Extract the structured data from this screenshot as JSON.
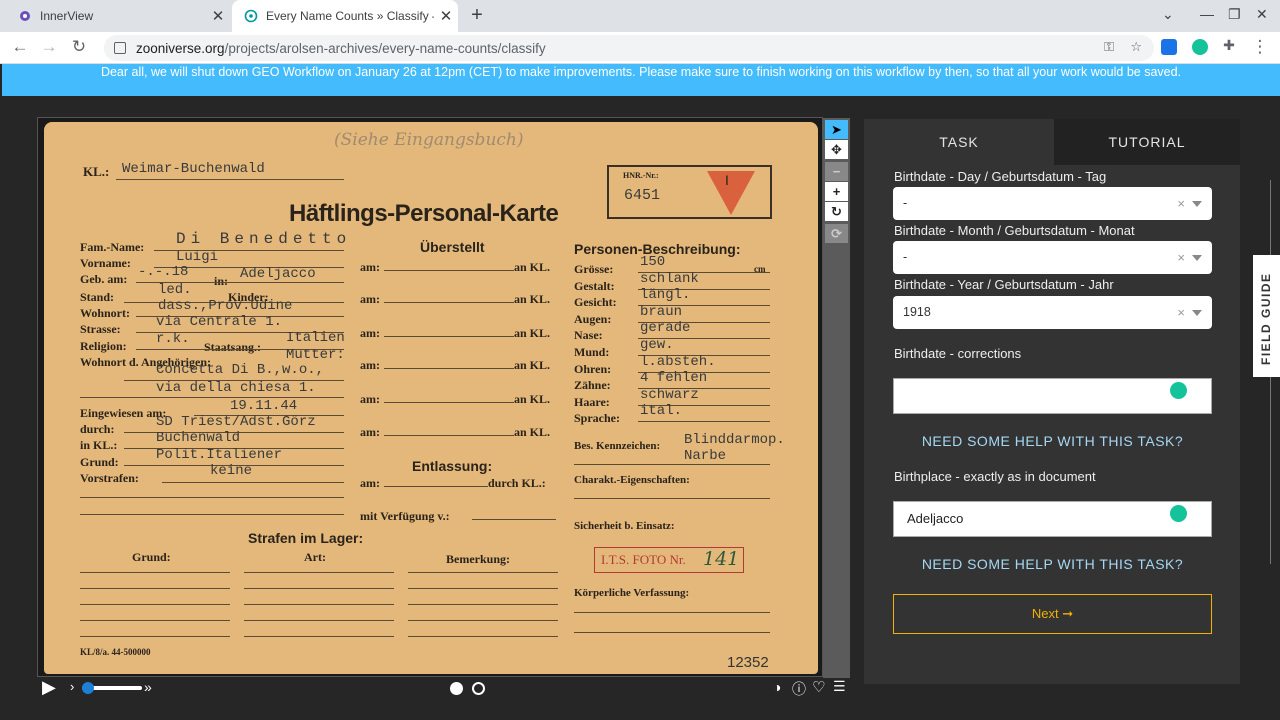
{
  "browser": {
    "tabs": [
      {
        "title": "InnerView"
      },
      {
        "title": "Every Name Counts » Classify –"
      }
    ],
    "url_domain": "zooniverse.org",
    "url_path": "/projects/arolsen-archives/every-name-counts/classify"
  },
  "banner": {
    "text": "Dear all, we will shut down GEO Workflow on January 26 at 12pm (CET) to make improvements. Please make sure to finish working on this workflow by then, so that all your work would be saved."
  },
  "card": {
    "pencil_note": "(Siehe Eingangsbuch)",
    "kl_label": "KL.:",
    "kl_value": "Weimar-Buchenwald",
    "title": "Häftlings-Personal-Karte",
    "hnr_label": "HNR.-Nr.:",
    "prisoner_number": "6451",
    "triangle_letter": "I",
    "ueberstellt": "Überstellt",
    "personen_beschreibung": "Personen-Beschreibung:",
    "left_fields": [
      {
        "label": "Fam.-Name:",
        "value": "Di Benedetto"
      },
      {
        "label": "Vorname:",
        "value": "Luigi"
      },
      {
        "label": "Geb. am:",
        "value": "-.-.18"
      },
      {
        "label": "Stand:",
        "value": "led."
      },
      {
        "label": "Wohnort:",
        "value": "dass.,Prov.Udine"
      },
      {
        "label": "Strasse:",
        "value": "via Centrale 1."
      },
      {
        "label": "Religion:",
        "value": "r.k."
      },
      {
        "label": "Wohnort d. Angehörigen:",
        "value": "Mutter:"
      }
    ],
    "in_label": "in:",
    "birthplace": "Adeljacco",
    "kinder_label": "Kinder:",
    "staatsang_label": "Staatsang.:",
    "staatsang_value": "Italien",
    "angehoerige_line2": "Concetta Di B.,w.o.,",
    "angehoerige_line3": "via della chiesa 1.",
    "eingewiesen_label": "Eingewiesen am:",
    "eingewiesen_value": "19.11.44",
    "durch_label": "durch:",
    "durch_value": "SD Triest/Adst.Görz",
    "in_kl_label": "in KL.:",
    "in_kl_value": "Buchenwald",
    "grund_label": "Grund:",
    "grund_value": "Polit.Italiener",
    "vorstrafen_label": "Vorstrafen:",
    "vorstrafen_value": "keine",
    "am_label": "am:",
    "an_kl_label": "an KL.",
    "entlassung": "Entlassung:",
    "durch_kl_label": "durch KL.:",
    "verfuegung_label": "mit Verfügung v.:",
    "description": [
      {
        "label": "Grösse:",
        "value": "150"
      },
      {
        "label": "Gestalt:",
        "value": "schlank"
      },
      {
        "label": "Gesicht:",
        "value": "längl."
      },
      {
        "label": "Augen:",
        "value": "braun"
      },
      {
        "label": "Nase:",
        "value": "gerade"
      },
      {
        "label": "Mund:",
        "value": "gew."
      },
      {
        "label": "Ohren:",
        "value": "l.absteh."
      },
      {
        "label": "Zähne:",
        "value": "4 fehlen"
      },
      {
        "label": "Haare:",
        "value": "schwarz"
      },
      {
        "label": "Sprache:",
        "value": "ital."
      }
    ],
    "cm_label": "cm",
    "kennzeichen_label": "Bes. Kennzeichen:",
    "kennzeichen_value": "Blinddarmop.",
    "kennzeichen_value2": "Narbe",
    "charakt_label": "Charakt.-Eigenschaften:",
    "sicherheit_label": "Sicherheit b. Einsatz:",
    "stamp_text": "I.T.S. FOTO Nr.",
    "stamp_number": "141",
    "koerper_label": "Körperliche Verfassung:",
    "strafen_title": "Strafen im Lager:",
    "strafen_cols": [
      "Grund:",
      "Art:",
      "Bemerkung:"
    ],
    "form_code": "KL/8/a. 44-500000",
    "doc_number": "12352"
  },
  "panel": {
    "tab_task": "TASK",
    "tab_tutorial": "TUTORIAL",
    "day_label": "Birthdate - Day / Geburtsdatum - Tag",
    "day_value": "-",
    "month_label": "Birthdate - Month / Geburtsdatum - Monat",
    "month_value": "-",
    "year_label": "Birthdate - Year / Geburtsdatum - Jahr",
    "year_value": "1918",
    "corrections_label": "Birthdate - corrections",
    "corrections_value": "",
    "help_text": "NEED SOME HELP WITH THIS TASK?",
    "birthplace_label": "Birthplace - exactly as in document",
    "birthplace_value": "Adeljacco",
    "next_label": "Next ➞"
  },
  "field_guide": "FIELD GUIDE"
}
